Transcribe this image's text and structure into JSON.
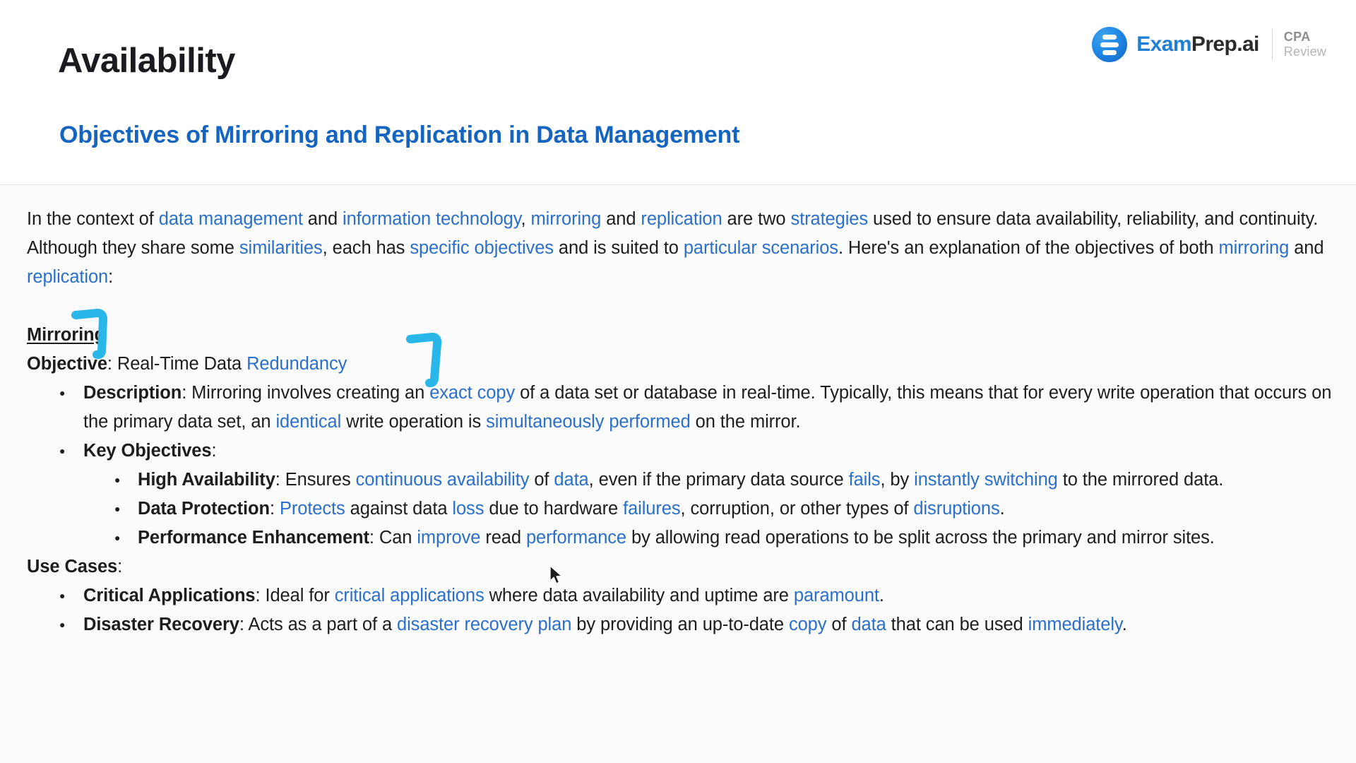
{
  "header": {
    "page_title": "Availability",
    "section_title": "Objectives of Mirroring and Replication in Data Management",
    "brand": {
      "logo_icon": "examprep-circle-bars-icon",
      "name_part1": "Exam",
      "name_part2": "Prep.ai",
      "sub_line1": "CPA",
      "sub_line2": "Review"
    }
  },
  "content": {
    "intro": {
      "t1": "In the context of ",
      "l1": "data management",
      "t2": " and ",
      "l2": "information technology",
      "t3": ", ",
      "l3": "mirroring",
      "t4": " and ",
      "l4": "replication",
      "t5": " are two ",
      "l5": "strategies",
      "t6": " used to ensure data availability, reliability, and continuity. Although they share some ",
      "l6": "similarities",
      "t7": ", each has ",
      "l7": "specific objectives",
      "t8": " and is suited to ",
      "l8": "particular scenarios",
      "t9": ". Here's an explanation of the objectives of both ",
      "l9": "mirroring",
      "t10": " and ",
      "l10": "replication",
      "t11": ":"
    },
    "mirroring_heading": "Mirroring",
    "objective_label": "Objective",
    "objective_text": ": Real-Time Data ",
    "objective_link": "Redundancy",
    "description": {
      "label": "Description",
      "t1": ": Mirroring involves creating an ",
      "l1": "exact copy",
      "t2": " of a data set or database in real-time. Typically, this means that for every write operation that occurs on the primary data set, an ",
      "l2": "identical",
      "t3": " write operation is ",
      "l3": "simultaneously performed",
      "t4": " on the mirror."
    },
    "key_objectives_label": "Key Objectives",
    "key_objectives_colon": ":",
    "key_objectives": [
      {
        "label": "High Availability",
        "t1": ": Ensures ",
        "l1": "continuous availability",
        "t2": " of ",
        "l2": "data",
        "t3": ", even if the primary data source ",
        "l3": "fails",
        "t4": ", by ",
        "l4": "instantly switching",
        "t5": " to the mirrored data."
      },
      {
        "label": "Data Protection",
        "t1": ": ",
        "l1": "Protects",
        "t2": " against data ",
        "l2": "loss",
        "t3": " due to hardware ",
        "l3": "failures",
        "t4": ", corruption, or other types of ",
        "l4": "disruptions",
        "t5": "."
      },
      {
        "label": "Performance Enhancement",
        "t1": ": Can ",
        "l1": "improve",
        "t2": " read ",
        "l2": "performance",
        "t3": " by allowing read operations to be split across the primary and mirror sites.",
        "l3": "",
        "t4": "",
        "l4": "",
        "t5": ""
      }
    ],
    "use_cases_label": "Use Cases",
    "use_cases_colon": ":",
    "use_cases": [
      {
        "label": "Critical Applications",
        "t1": ": Ideal for ",
        "l1": "critical applications",
        "t2": " where data availability and uptime are ",
        "l2": "paramount",
        "t3": ".",
        "l3": "",
        "t4": "",
        "l4": "",
        "t5": ""
      },
      {
        "label": "Disaster Recovery",
        "t1": ": Acts as a part of a ",
        "l1": "disaster recovery plan",
        "t2": " by providing an up-to-date ",
        "l2": "copy",
        "t3": " of ",
        "l3": "data",
        "t4": " that can be used ",
        "l4": "immediately",
        "t5": "."
      }
    ]
  },
  "annotations": {
    "color": "#29b6e8",
    "marks": [
      {
        "name": "hook-mark-mirroring"
      },
      {
        "name": "hook-mark-redundancy"
      }
    ]
  },
  "colors": {
    "link_blue": "#2a6fc9",
    "heading_blue": "#1565c0",
    "annotation_cyan": "#29b6e8",
    "text_black": "#1d1d1d"
  }
}
